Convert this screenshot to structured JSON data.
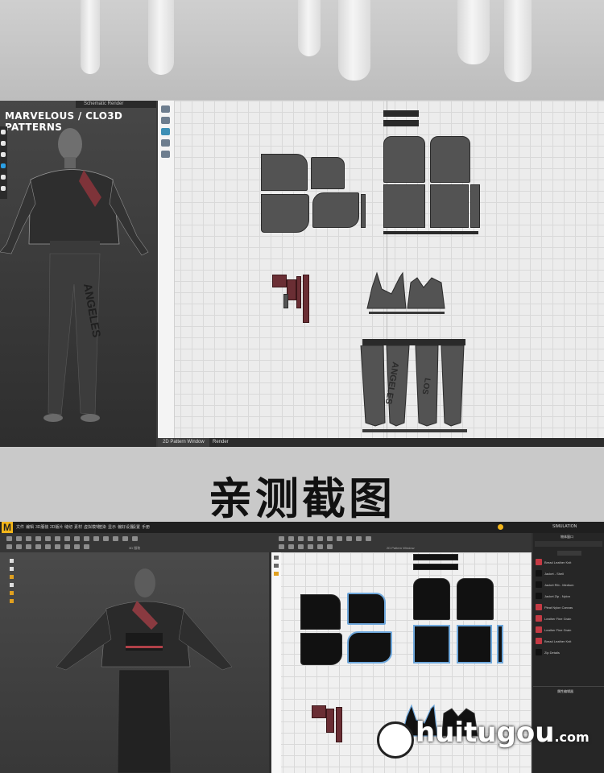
{
  "screen1": {
    "header_title": "Schematic Render",
    "overlay_title": "MARVELOUS / CLO3D PATTERNS",
    "tabs": [
      "2D Pattern Window",
      "Render"
    ],
    "print_front": "ANGELES",
    "print_back": "LOS"
  },
  "caption": "亲测截图",
  "screen2": {
    "logo": "M",
    "menu": [
      "文件",
      "编辑",
      "3D服装",
      "2D版片",
      "缝纫",
      "素材",
      "虚拟模特",
      "渲染",
      "显示",
      "偏好设置",
      "设置",
      "手册"
    ],
    "sim_label": "SIMULATION",
    "view_3d_label": "3D 服装",
    "view_2d_label": "2D Pattern Window",
    "panel_title": "物体窗口",
    "panel_items": [
      "Bread Leather Knit",
      "Jacket - Shell",
      "Jacket Rib - Medium",
      "Jacket Zip - Nylon",
      "Pleat Nylon Canvas",
      "Leather Fine Grain",
      "Leather Fine Grain",
      "Bread Leather Knit",
      "Zip Details"
    ],
    "panel_footer": "属性编辑器"
  },
  "watermark": {
    "text": "huitugou",
    "suffix": ".com"
  },
  "colors": {
    "accent": "#f2b51a",
    "pattern_red": "#6a2e34",
    "selection_blue": "#6fa8dc"
  }
}
